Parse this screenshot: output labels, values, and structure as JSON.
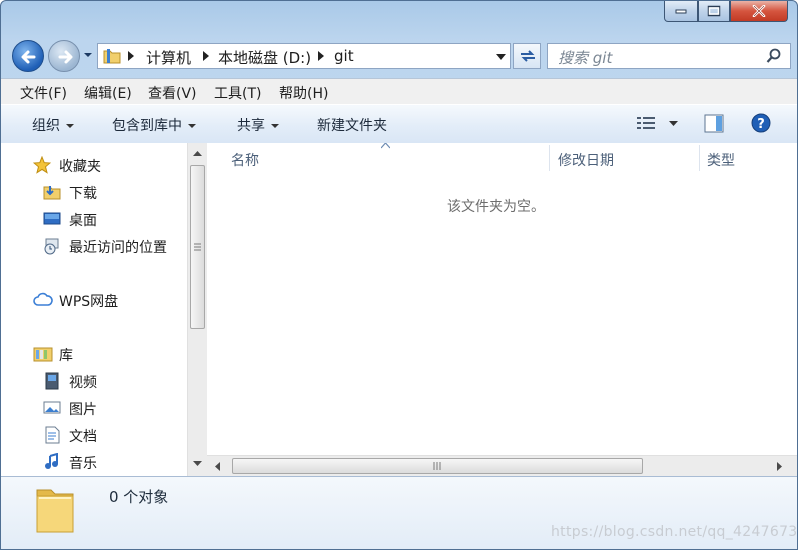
{
  "address": {
    "crumbs": [
      "计算机",
      "本地磁盘 (D:)",
      "git"
    ]
  },
  "search": {
    "placeholder": "搜索 git"
  },
  "menu": [
    "文件(F)",
    "编辑(E)",
    "查看(V)",
    "工具(T)",
    "帮助(H)"
  ],
  "toolbar": {
    "organize": "组织",
    "include_in_library": "包含到库中",
    "share": "共享",
    "new_folder": "新建文件夹"
  },
  "nav": {
    "favorites": {
      "label": "收藏夹",
      "items": [
        "下载",
        "桌面",
        "最近访问的位置"
      ]
    },
    "wps": "WPS网盘",
    "libraries": {
      "label": "库",
      "items": [
        "视频",
        "图片",
        "文档",
        "音乐"
      ]
    }
  },
  "columns": [
    "名称",
    "修改日期",
    "类型"
  ],
  "empty_message": "该文件夹为空。",
  "status": {
    "count": "0 个对象"
  },
  "watermark": "https://blog.csdn.net/qq_4247673",
  "colors": {
    "accent": "#1f5fb6",
    "frame": "#bcd5ee"
  }
}
